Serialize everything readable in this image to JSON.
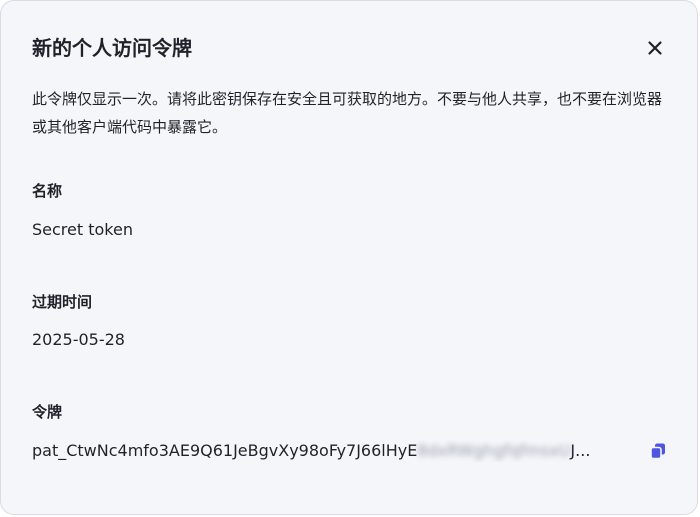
{
  "dialog": {
    "title": "新的个人访问令牌",
    "description": "此令牌仅显示一次。请将此密钥保存在安全且可获取的地方。不要与他人共享，也不要在浏览器或其他客户端代码中暴露它。"
  },
  "fields": {
    "name": {
      "label": "名称",
      "value": "Secret token"
    },
    "expiry": {
      "label": "过期时间",
      "value": "2025-05-28"
    },
    "token": {
      "label": "令牌",
      "value_visible": "pat_CtwNc4mfo3AE9Q61JeBgvXy98oFy7J66lHyE",
      "value_obscured": "8dxRWghgfqfmsxU",
      "ellipsis": "J..."
    }
  },
  "icons": {
    "close": "close-icon",
    "copy": "copy-icon"
  },
  "colors": {
    "dialog_background": "#f5f6fa",
    "text": "#1f2329",
    "copy_icon": "#4e55e0"
  }
}
